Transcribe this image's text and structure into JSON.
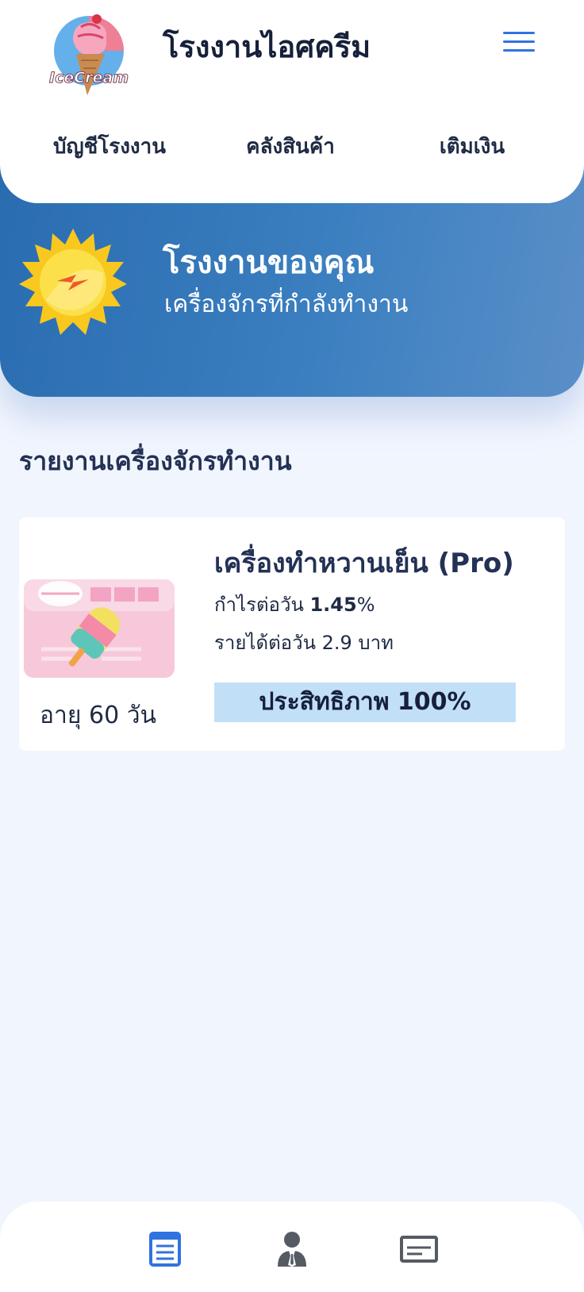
{
  "header": {
    "logo_text": "IceCream",
    "title": "โรงงานไอศครีม",
    "nav": [
      "บัญชีโรงงาน",
      "คลังสินค้า",
      "เติมเงิน"
    ]
  },
  "banner": {
    "title": "โรงงานของคุณ",
    "subtitle": "เครื่องจักรที่กำลังทำงาน"
  },
  "section": {
    "title": "รายงานเครื่องจักรทำงาน"
  },
  "machine": {
    "name": "เครื่องทำหวานเย็น (Pro)",
    "profit_label": "กำไรต่อวัน ",
    "profit_value": "1.45",
    "profit_unit": "%",
    "income_text": "รายได้ต่อวัน 2.9 บาท",
    "life_text": "อายุ 60 วัน",
    "efficiency_text": "ประสิทธิภาพ 100%"
  },
  "bottom_tabs": [
    {
      "icon": "document-list-icon",
      "active": true
    },
    {
      "icon": "user-tie-icon",
      "active": false
    },
    {
      "icon": "card-icon",
      "active": false
    }
  ],
  "colors": {
    "accent": "#2f73e0",
    "banner": "#2a6cb0",
    "background": "#f1f5fe",
    "efficiency_bar": "#c2dff8"
  }
}
